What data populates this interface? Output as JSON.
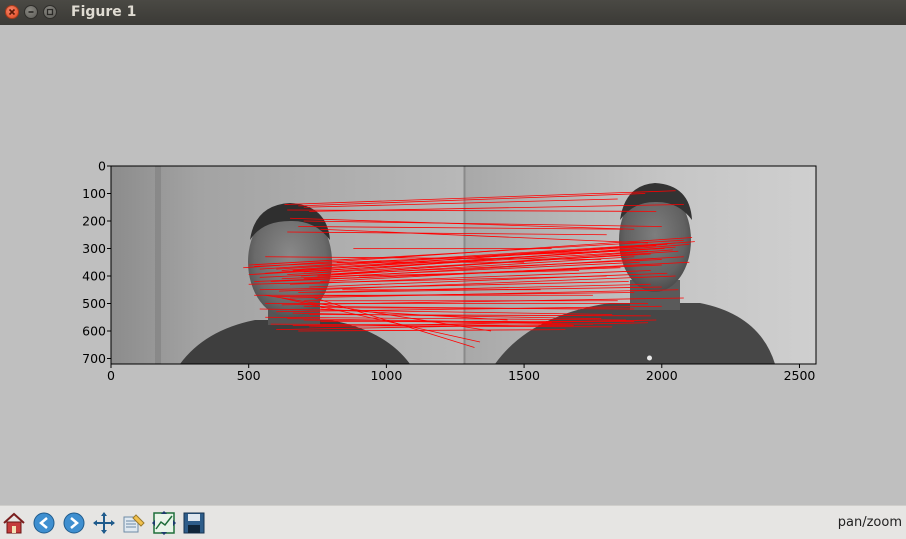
{
  "window": {
    "title": "Figure 1"
  },
  "toolbar": {
    "buttons": [
      {
        "name": "home-button",
        "icon": "home-icon"
      },
      {
        "name": "back-button",
        "icon": "arrow-left-icon"
      },
      {
        "name": "forward-button",
        "icon": "arrow-right-icon"
      },
      {
        "name": "pan-button",
        "icon": "move-arrows-icon"
      },
      {
        "name": "configure-subplots-button",
        "icon": "subplots-icon"
      },
      {
        "name": "edit-axis-button",
        "icon": "edit-curves-icon"
      },
      {
        "name": "save-button",
        "icon": "floppy-disk-icon"
      }
    ],
    "mode_text": "pan/zoom"
  },
  "colors": {
    "match_lines": "#ff0000",
    "background": "#bfbfbf",
    "toolbar": "#e6e5e3"
  },
  "chart_data": {
    "type": "image",
    "xlim": [
      0,
      2560
    ],
    "ylim": [
      720,
      0
    ],
    "xticks": [
      0,
      500,
      1000,
      1500,
      2000,
      2500
    ],
    "yticks": [
      0,
      100,
      200,
      300,
      400,
      500,
      600,
      700
    ],
    "split_x": 1280,
    "title": "",
    "xlabel": "",
    "ylabel": "",
    "match_lines": [
      [
        630,
        140,
        2050,
        90
      ],
      [
        680,
        145,
        1940,
        100
      ],
      [
        700,
        150,
        1840,
        120
      ],
      [
        640,
        160,
        1980,
        165
      ],
      [
        720,
        165,
        2080,
        140
      ],
      [
        650,
        190,
        1900,
        230
      ],
      [
        700,
        200,
        2000,
        220
      ],
      [
        760,
        230,
        1950,
        280
      ],
      [
        560,
        330,
        1780,
        340
      ],
      [
        500,
        360,
        2080,
        270
      ],
      [
        520,
        365,
        2010,
        300
      ],
      [
        480,
        370,
        2110,
        260
      ],
      [
        540,
        375,
        2050,
        280
      ],
      [
        600,
        375,
        2020,
        285
      ],
      [
        620,
        380,
        1980,
        290
      ],
      [
        660,
        380,
        2000,
        300
      ],
      [
        700,
        385,
        2050,
        295
      ],
      [
        720,
        390,
        2100,
        285
      ],
      [
        500,
        395,
        1950,
        310
      ],
      [
        560,
        390,
        2120,
        275
      ],
      [
        640,
        395,
        1960,
        320
      ],
      [
        690,
        400,
        2060,
        310
      ],
      [
        750,
        400,
        1900,
        330
      ],
      [
        800,
        395,
        2040,
        305
      ],
      [
        540,
        405,
        2000,
        340
      ],
      [
        620,
        410,
        1920,
        350
      ],
      [
        700,
        410,
        2080,
        330
      ],
      [
        520,
        420,
        1850,
        370
      ],
      [
        580,
        420,
        2000,
        360
      ],
      [
        760,
        420,
        2100,
        350
      ],
      [
        500,
        430,
        1800,
        400
      ],
      [
        650,
        430,
        1960,
        380
      ],
      [
        720,
        440,
        2020,
        390
      ],
      [
        540,
        450,
        1880,
        420
      ],
      [
        610,
        455,
        2050,
        400
      ],
      [
        680,
        460,
        1960,
        430
      ],
      [
        760,
        460,
        2000,
        440
      ],
      [
        520,
        470,
        1750,
        470
      ],
      [
        590,
        475,
        1900,
        460
      ],
      [
        650,
        480,
        2060,
        450
      ],
      [
        700,
        490,
        1840,
        490
      ],
      [
        560,
        500,
        1950,
        500
      ],
      [
        620,
        505,
        2080,
        480
      ],
      [
        700,
        510,
        1700,
        520
      ],
      [
        760,
        515,
        1900,
        520
      ],
      [
        540,
        520,
        1820,
        540
      ],
      [
        600,
        530,
        2000,
        510
      ],
      [
        660,
        535,
        1780,
        555
      ],
      [
        720,
        540,
        1960,
        545
      ],
      [
        560,
        550,
        1870,
        560
      ],
      [
        640,
        555,
        1600,
        570
      ],
      [
        700,
        560,
        1750,
        575
      ],
      [
        760,
        565,
        1900,
        565
      ],
      [
        580,
        575,
        1680,
        580
      ],
      [
        660,
        580,
        1820,
        585
      ],
      [
        720,
        585,
        1980,
        560
      ],
      [
        600,
        595,
        1950,
        570
      ],
      [
        680,
        600,
        1650,
        595
      ],
      [
        560,
        470,
        1380,
        600
      ],
      [
        620,
        480,
        1340,
        640
      ],
      [
        740,
        480,
        1320,
        660
      ],
      [
        820,
        350,
        1500,
        350
      ],
      [
        880,
        300,
        1600,
        300
      ],
      [
        760,
        520,
        1440,
        560
      ],
      [
        840,
        450,
        1560,
        450
      ],
      [
        900,
        400,
        1700,
        380
      ],
      [
        640,
        240,
        1800,
        250
      ],
      [
        680,
        220,
        1860,
        230
      ]
    ]
  }
}
